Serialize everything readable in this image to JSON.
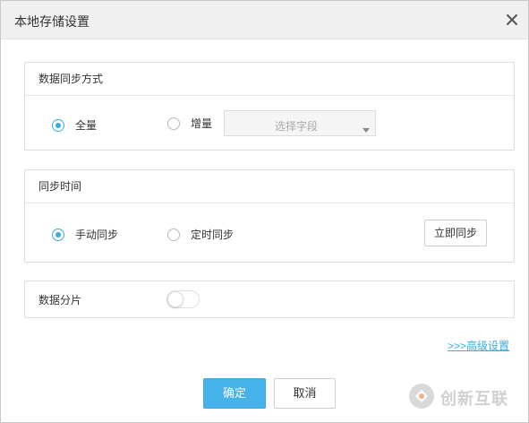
{
  "dialog": {
    "title": "本地存储设置"
  },
  "sync_mode": {
    "heading": "数据同步方式",
    "option_full": "全量",
    "option_incremental": "增量",
    "selected": "全量",
    "field_select_placeholder": "选择字段"
  },
  "sync_time": {
    "heading": "同步时间",
    "option_manual": "手动同步",
    "option_scheduled": "定时同步",
    "selected": "手动同步",
    "sync_now_label": "立即同步"
  },
  "sharding": {
    "label": "数据分片",
    "enabled": false
  },
  "advanced_link": ">>>高级设置",
  "footer": {
    "ok_label": "确定",
    "cancel_label": "取消"
  },
  "watermark": {
    "text": "创新互联"
  },
  "colors": {
    "accent": "#3aa9e4",
    "ok_button": "#45b2ea",
    "titlebar": "#f0f0f0"
  },
  "icons": {
    "close": "close-icon",
    "caret": "caret-down-icon",
    "watermark_logo": "watermark-logo-icon"
  }
}
